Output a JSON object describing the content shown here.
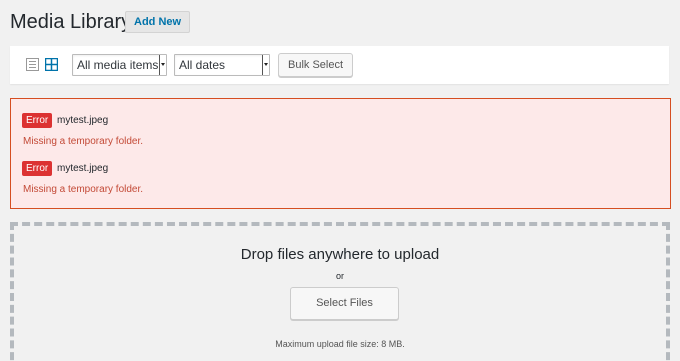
{
  "header": {
    "title": "Media Library",
    "add_new_label": "Add New"
  },
  "toolbar": {
    "view_list_icon": "list-view-icon",
    "view_grid_icon": "grid-view-icon",
    "media_type_selected": "All media items",
    "date_selected": "All dates",
    "bulk_select_label": "Bulk Select"
  },
  "errors": [
    {
      "badge": "Error",
      "file": "mytest.jpeg",
      "message": "Missing a temporary folder."
    },
    {
      "badge": "Error",
      "file": "mytest.jpeg",
      "message": "Missing a temporary folder."
    }
  ],
  "upload": {
    "title": "Drop files anywhere to upload",
    "or_text": "or",
    "select_files_label": "Select Files",
    "max_size_text": "Maximum upload file size: 8 MB."
  },
  "colors": {
    "accent": "#0073aa",
    "error_badge": "#dc3232",
    "error_text": "#c34a37",
    "error_bg": "#fde9e9",
    "error_border": "#d54e21"
  }
}
